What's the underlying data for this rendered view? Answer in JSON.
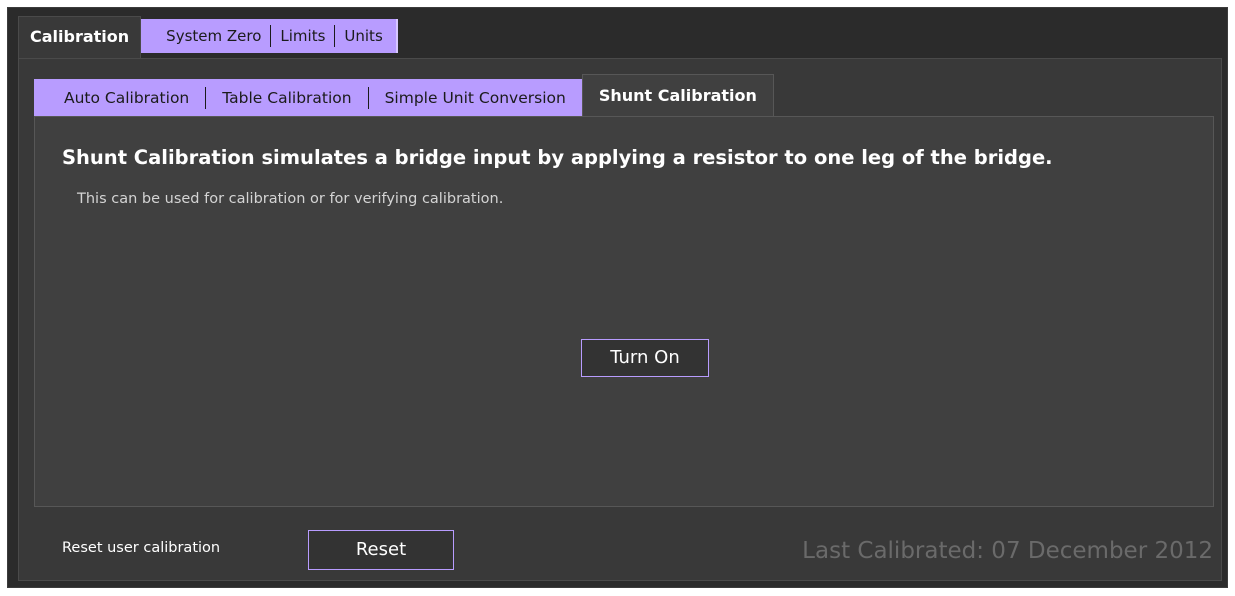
{
  "top_tabs": {
    "active": "Calibration",
    "others": [
      "System Zero",
      "Limits",
      "Units"
    ]
  },
  "inner_tabs": {
    "others": [
      "Auto Calibration",
      "Table Calibration",
      "Simple Unit Conversion"
    ],
    "active": "Shunt Calibration"
  },
  "panel": {
    "headline": "Shunt Calibration simulates a bridge input by applying a resistor to one leg of the bridge.",
    "subtext": "This can be used for calibration or for verifying calibration.",
    "turn_on_label": "Turn On"
  },
  "footer": {
    "reset_label": "Reset user calibration",
    "reset_button": "Reset",
    "last_calibrated": "Last Calibrated: 07 December 2012"
  },
  "colors": {
    "accent": "#b89cff",
    "background": "#393939",
    "inner_background": "#404040"
  }
}
